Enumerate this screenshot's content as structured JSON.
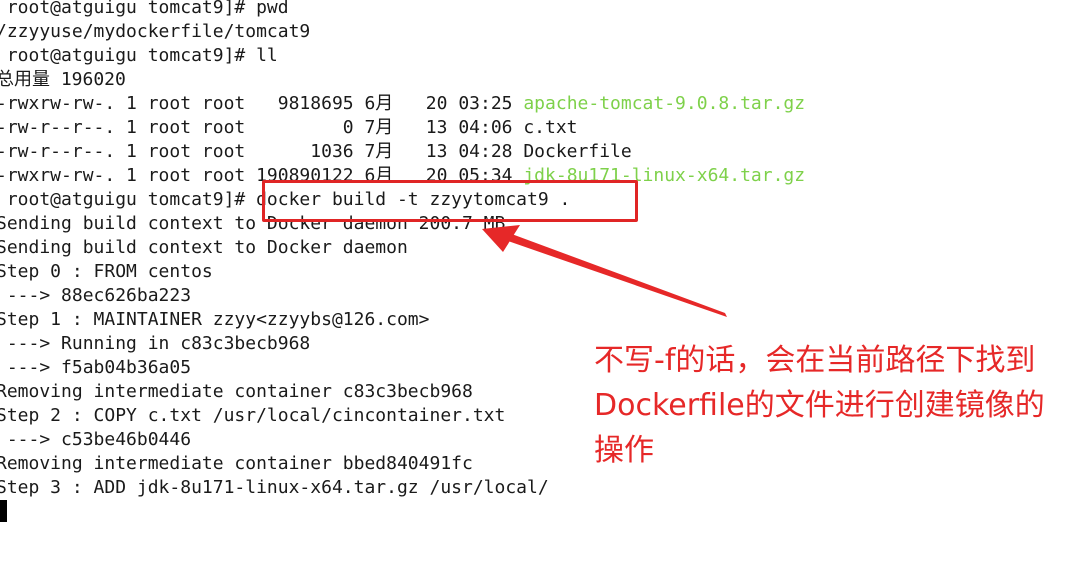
{
  "terminal": {
    "lines": [
      {
        "segments": [
          {
            "text": " root@atguigu tomcat9]# pwd"
          }
        ]
      },
      {
        "segments": [
          {
            "text": "/zzyyuse/mydockerfile/tomcat9"
          }
        ]
      },
      {
        "segments": [
          {
            "text": " root@atguigu tomcat9]# ll"
          }
        ]
      },
      {
        "segments": [
          {
            "text": "总用量 196020"
          }
        ]
      },
      {
        "segments": [
          {
            "text": "-rwxrw-rw-. 1 root root   9818695 6月   20 03:25 "
          },
          {
            "text": "apache-tomcat-9.0.8.tar.gz",
            "color": "green"
          }
        ]
      },
      {
        "segments": [
          {
            "text": "-rw-r--r--. 1 root root         0 7月   13 04:06 c.txt"
          }
        ]
      },
      {
        "segments": [
          {
            "text": "-rw-r--r--. 1 root root      1036 7月   13 04:28 Dockerfile"
          }
        ]
      },
      {
        "segments": [
          {
            "text": "-rwxrw-rw-. 1 root root 190890122 6月   20 05:34 "
          },
          {
            "text": "jdk-8u171-linux-x64.tar.gz",
            "color": "green"
          }
        ]
      },
      {
        "segments": [
          {
            "text": " root@atguigu tomcat9]# docker build -t zzyytomcat9 ."
          }
        ]
      },
      {
        "segments": [
          {
            "text": "Sending build context to Docker daemon 200.7 MB"
          }
        ]
      },
      {
        "segments": [
          {
            "text": "Sending build context to Docker daemon"
          }
        ]
      },
      {
        "segments": [
          {
            "text": "Step 0 : FROM centos"
          }
        ]
      },
      {
        "segments": [
          {
            "text": " ---> 88ec626ba223"
          }
        ]
      },
      {
        "segments": [
          {
            "text": "Step 1 : MAINTAINER zzyy<zzyybs@126.com>"
          }
        ]
      },
      {
        "segments": [
          {
            "text": " ---> Running in c83c3becb968"
          }
        ]
      },
      {
        "segments": [
          {
            "text": " ---> f5ab04b36a05"
          }
        ]
      },
      {
        "segments": [
          {
            "text": "Removing intermediate container c83c3becb968"
          }
        ]
      },
      {
        "segments": [
          {
            "text": "Step 2 : COPY c.txt /usr/local/cincontainer.txt"
          }
        ]
      },
      {
        "segments": [
          {
            "text": " ---> c53be46b0446"
          }
        ]
      },
      {
        "segments": [
          {
            "text": "Removing intermediate container bbed840491fc"
          }
        ]
      },
      {
        "segments": [
          {
            "text": "Step 3 : ADD jdk-8u171-linux-x64.tar.gz /usr/local/"
          }
        ]
      }
    ]
  },
  "annotation": {
    "text": "不写-f的话，会在当前路径下找到Dockerfile的文件进行创建镜像的操作"
  },
  "colors": {
    "terminal_text": "#1a1a1a",
    "executable_file": "#7ed14a",
    "annotation": "#e62828",
    "background": "#ffffff"
  }
}
